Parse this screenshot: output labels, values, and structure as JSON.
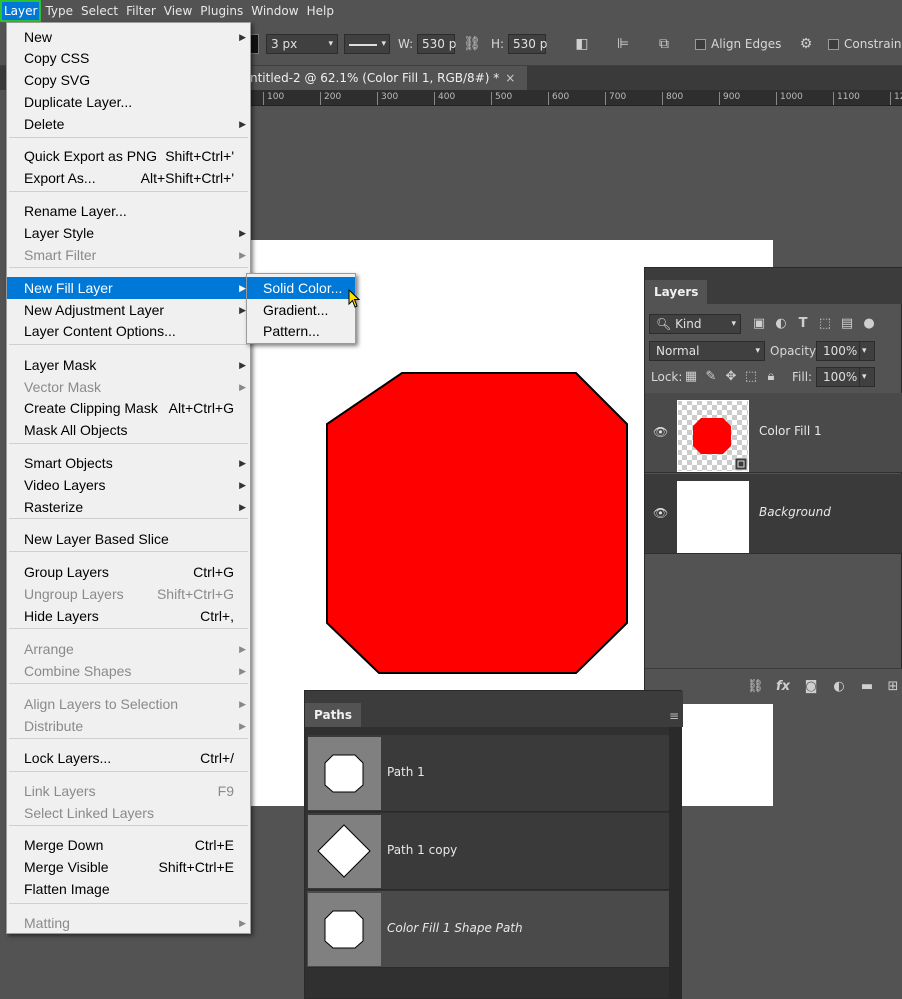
{
  "menubar": {
    "items": [
      "Layer",
      "Type",
      "Select",
      "Filter",
      "View",
      "Plugins",
      "Window",
      "Help"
    ]
  },
  "options": {
    "stroke_width": "3 px",
    "w_label": "W:",
    "w_value": "530 p",
    "h_label": "H:",
    "h_value": "530 p",
    "align_edges": "Align Edges",
    "constrain": "Constrain P"
  },
  "document": {
    "tab_title": "ntitled-2 @ 62.1% (Color Fill 1, RGB/8#) *",
    "tab_close": "×",
    "ruler_labels": [
      "100",
      "200",
      "300",
      "400",
      "500",
      "600",
      "700",
      "800",
      "900",
      "1000",
      "1100",
      "12"
    ]
  },
  "shape": {
    "fill": "#ff0000",
    "stroke": "#000000"
  },
  "layer_menu": {
    "items": [
      {
        "label": "New",
        "shortcut": "",
        "submenu": true,
        "disabled": false
      },
      {
        "label": "Copy CSS",
        "shortcut": "",
        "submenu": false,
        "disabled": false
      },
      {
        "label": "Copy SVG",
        "shortcut": "",
        "submenu": false,
        "disabled": false
      },
      {
        "label": "Duplicate Layer...",
        "shortcut": "",
        "submenu": false,
        "disabled": false
      },
      {
        "label": "Delete",
        "shortcut": "",
        "submenu": true,
        "disabled": false
      },
      {
        "label": "Quick Export as PNG",
        "shortcut": "Shift+Ctrl+'",
        "submenu": false,
        "disabled": false
      },
      {
        "label": "Export As...",
        "shortcut": "Alt+Shift+Ctrl+'",
        "submenu": false,
        "disabled": false
      },
      {
        "label": "Rename Layer...",
        "shortcut": "",
        "submenu": false,
        "disabled": false
      },
      {
        "label": "Layer Style",
        "shortcut": "",
        "submenu": true,
        "disabled": false
      },
      {
        "label": "Smart Filter",
        "shortcut": "",
        "submenu": true,
        "disabled": true
      },
      {
        "label": "New Fill Layer",
        "shortcut": "",
        "submenu": true,
        "disabled": false,
        "highlight": true
      },
      {
        "label": "New Adjustment Layer",
        "shortcut": "",
        "submenu": true,
        "disabled": false
      },
      {
        "label": "Layer Content Options...",
        "shortcut": "",
        "submenu": false,
        "disabled": false
      },
      {
        "label": "Layer Mask",
        "shortcut": "",
        "submenu": true,
        "disabled": false
      },
      {
        "label": "Vector Mask",
        "shortcut": "",
        "submenu": true,
        "disabled": true
      },
      {
        "label": "Create Clipping Mask",
        "shortcut": "Alt+Ctrl+G",
        "submenu": false,
        "disabled": false
      },
      {
        "label": "Mask All Objects",
        "shortcut": "",
        "submenu": false,
        "disabled": false
      },
      {
        "label": "Smart Objects",
        "shortcut": "",
        "submenu": true,
        "disabled": false
      },
      {
        "label": "Video Layers",
        "shortcut": "",
        "submenu": true,
        "disabled": false
      },
      {
        "label": "Rasterize",
        "shortcut": "",
        "submenu": true,
        "disabled": false
      },
      {
        "label": "New Layer Based Slice",
        "shortcut": "",
        "submenu": false,
        "disabled": false
      },
      {
        "label": "Group Layers",
        "shortcut": "Ctrl+G",
        "submenu": false,
        "disabled": false
      },
      {
        "label": "Ungroup Layers",
        "shortcut": "Shift+Ctrl+G",
        "submenu": false,
        "disabled": true
      },
      {
        "label": "Hide Layers",
        "shortcut": "Ctrl+,",
        "submenu": false,
        "disabled": false
      },
      {
        "label": "Arrange",
        "shortcut": "",
        "submenu": true,
        "disabled": true
      },
      {
        "label": "Combine Shapes",
        "shortcut": "",
        "submenu": true,
        "disabled": true
      },
      {
        "label": "Align Layers to Selection",
        "shortcut": "",
        "submenu": true,
        "disabled": true
      },
      {
        "label": "Distribute",
        "shortcut": "",
        "submenu": true,
        "disabled": true
      },
      {
        "label": "Lock Layers...",
        "shortcut": "Ctrl+/",
        "submenu": false,
        "disabled": false
      },
      {
        "label": "Link Layers",
        "shortcut": "F9",
        "submenu": false,
        "disabled": true
      },
      {
        "label": "Select Linked Layers",
        "shortcut": "",
        "submenu": false,
        "disabled": true
      },
      {
        "label": "Merge Down",
        "shortcut": "Ctrl+E",
        "submenu": false,
        "disabled": false
      },
      {
        "label": "Merge Visible",
        "shortcut": "Shift+Ctrl+E",
        "submenu": false,
        "disabled": false
      },
      {
        "label": "Flatten Image",
        "shortcut": "",
        "submenu": false,
        "disabled": false
      },
      {
        "label": "Matting",
        "shortcut": "",
        "submenu": true,
        "disabled": true
      }
    ]
  },
  "fill_submenu": {
    "items": [
      "Solid Color...",
      "Gradient...",
      "Pattern..."
    ]
  },
  "layers_panel": {
    "tab": "Layers",
    "filter_kind": "Kind",
    "blend_mode": "Normal",
    "opacity_label": "Opacity:",
    "opacity_value": "100%",
    "lock_label": "Lock:",
    "fill_label": "Fill:",
    "fill_value": "100%",
    "layers": [
      {
        "name": "Color Fill 1",
        "selected": true
      },
      {
        "name": "Background",
        "selected": false
      }
    ],
    "footer_icons": [
      "link-icon",
      "fx-icon",
      "mask-icon",
      "adjustment-icon",
      "folder-icon",
      "new-layer-icon"
    ]
  },
  "paths_panel": {
    "tab": "Paths",
    "paths": [
      {
        "name": "Path 1",
        "shape": "octagon"
      },
      {
        "name": "Path 1 copy",
        "shape": "diamond"
      },
      {
        "name": "Color Fill 1 Shape Path",
        "shape": "octagon",
        "italic": true
      }
    ]
  }
}
